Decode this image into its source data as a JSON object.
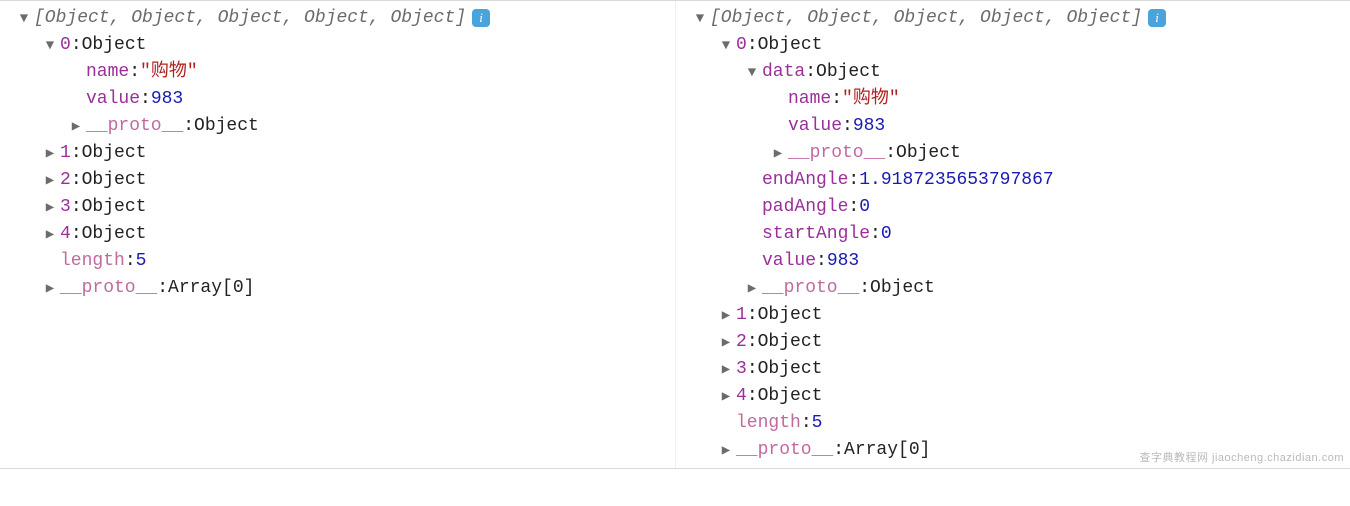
{
  "glyphs": {
    "arrow_down": "▼",
    "arrow_right": "▶",
    "info": "i"
  },
  "common": {
    "object": "Object",
    "array0": "Array[0]",
    "sep": ": ",
    "proto": "__proto__",
    "length_key": "length"
  },
  "left": {
    "header": "[Object, Object, Object, Object, Object]",
    "item0": {
      "key": "0",
      "name_key": "name",
      "name_val": "\"购物\"",
      "value_key": "value",
      "value_val": "983"
    },
    "rest_keys": [
      "1",
      "2",
      "3",
      "4"
    ],
    "length_val": "5"
  },
  "right": {
    "header": "[Object, Object, Object, Object, Object]",
    "item0": {
      "key": "0",
      "data_key": "data",
      "data": {
        "name_key": "name",
        "name_val": "\"购物\"",
        "value_key": "value",
        "value_val": "983"
      },
      "endAngle_key": "endAngle",
      "endAngle_val": "1.9187235653797867",
      "padAngle_key": "padAngle",
      "padAngle_val": "0",
      "startAngle_key": "startAngle",
      "startAngle_val": "0",
      "value_key": "value",
      "value_val": "983"
    },
    "rest_keys": [
      "1",
      "2",
      "3",
      "4"
    ],
    "length_val": "5"
  },
  "watermark": "查字典教程网 jiaocheng.chazidian.com"
}
